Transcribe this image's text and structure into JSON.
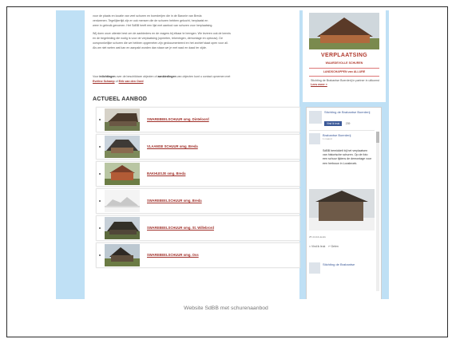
{
  "caption": "Website SdBB met schurenaanbod",
  "article": {
    "intro_lines": [
      "voor de plaats en locatie van veel schuren en boerderijen die in de Baronie van Breda",
      "verdwenen. Tegelijkertijd zijn er ook mensen die de schuren hebben gekocht, herplaatst en",
      "weer in gebruik genomen. Het SdBB heeft een lijst met aanbod van schuren voor herplaatsing."
    ],
    "para2_lines": [
      "Wij doen onze uiterste best om de aanbieders en de vragers bij elkaar te brengen. We leveren ook de kennis",
      "en de begeleiding die nodig is voor de verplaatsing (opmeten, tekeningen, demontage en opbouw). De",
      "oorspronkelijke schuren die we hebben opgemeten zijn gedocumenteerd en het archief staat open voor all.",
      "Als we niet weten wat kan en aanpakt worden dan staan we je met raad en daad ter zijde."
    ],
    "contact_prefix": "Voor ",
    "contact_bold": "inlichtingen",
    "contact_mid": " over de beschikbare objecten of ",
    "contact_bold2": "aanbiedingen",
    "contact_suffix": " van objecten kunt u contact opnemen met",
    "contact_name1": "Eveline Schamp",
    "contact_or": " of ",
    "contact_name2": "Erik van den Oord",
    "section_title": "ACTUEEL AANBOD",
    "listings": [
      {
        "label": "SWAREBEELSCHUUR omg. Dinteloord"
      },
      {
        "label": "VLAAMSE SCHUUR omg. Breda"
      },
      {
        "label": "BAKHUISJE omg. Breda"
      },
      {
        "label": "SWAREBEELSCHUUR omg. Breda"
      },
      {
        "label": "SWAREBEELSCHUUR omg. St. Willebrord"
      },
      {
        "label": "SWAREBEELSCHUUR omg. Oss"
      }
    ]
  },
  "sidebar": {
    "ad_title": "VERPLAATSING",
    "ad_sub": "WAARDEVOLLE SCHUREN",
    "ad_sub2": "LANDSCHAPPEN van ALLURE",
    "ad_text": "Stichting de Brabantse Boerderij in partner in uitkomst",
    "ad_link": "Lees meer »",
    "fb_page_name": "Stichting de Brabantse Boerderij",
    "fb_like": "Vind ik leuk",
    "fb_count": "239",
    "fb_post_name": "Brabantse Boerderij",
    "fb_post_time": "1 maand",
    "fb_post_text": "SdBB bemiddelt bij het verplaatsen van historische schuren. Op de foto een schuur tijdens de demontage voor een herbouw in Loosbroek.",
    "fb_post_meta": "25 vind-ik-leuks",
    "fb_action_like": "Vind ik leuk",
    "fb_action_share": "Delen",
    "fb_name2": "Stichting de Brabantse"
  },
  "colors": {
    "background": "#bfe0f5",
    "accent": "#a0302a",
    "facebook": "#3b5998"
  }
}
